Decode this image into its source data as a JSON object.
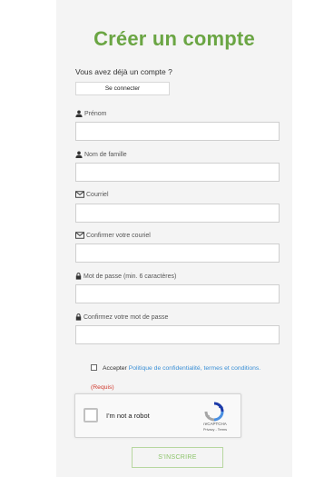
{
  "header": {
    "title": "Créer un compte"
  },
  "login": {
    "prompt": "Vous avez déjà un compte ?",
    "button_label": "Se connecter"
  },
  "fields": [
    {
      "label": "Prénom",
      "icon": "user-icon",
      "value": ""
    },
    {
      "label": "Nom de famille",
      "icon": "user-icon",
      "value": ""
    },
    {
      "label": "Courriel",
      "icon": "envelope-icon",
      "value": ""
    },
    {
      "label": "Confirmer votre couriel",
      "icon": "envelope-icon",
      "value": ""
    },
    {
      "label": "Mot de passe (min. 6 caractères)",
      "icon": "lock-icon",
      "value": ""
    },
    {
      "label": "Confirmez votre mot de passe",
      "icon": "lock-icon",
      "value": ""
    }
  ],
  "terms": {
    "accept": "Accepter",
    "link": "Politique de confidentialité, termes et conditions.",
    "required": "(Requis)",
    "checked": false
  },
  "recaptcha": {
    "label": "I'm not a robot",
    "brand": "reCAPTCHA",
    "links": "Privacy - Terms",
    "checked": false
  },
  "submit": {
    "label": "S'INSCRIRE"
  },
  "colors": {
    "title": "#6aa543",
    "link": "#3a8fd6",
    "required": "#d23b2f",
    "submit_text": "#8cc46a",
    "panel_bg": "#f4f4f4"
  }
}
